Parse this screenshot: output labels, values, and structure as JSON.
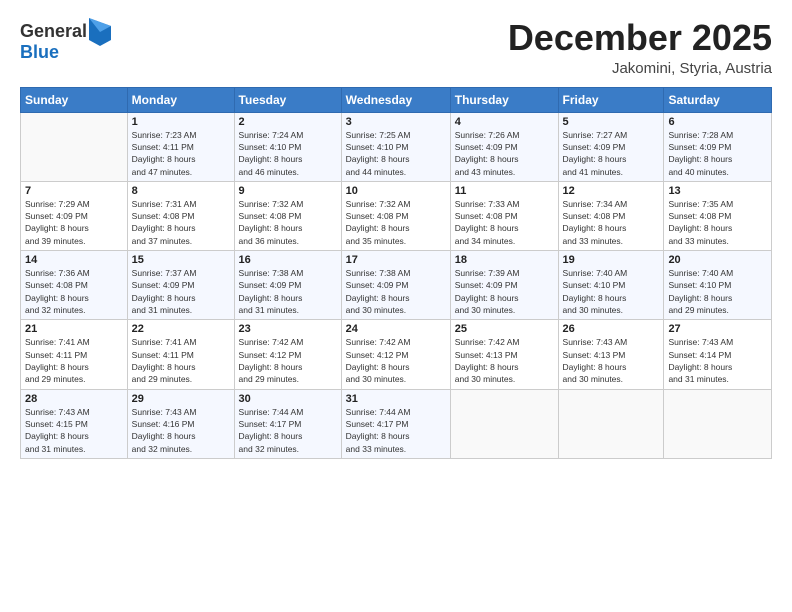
{
  "logo": {
    "general": "General",
    "blue": "Blue"
  },
  "header": {
    "month": "December 2025",
    "location": "Jakomini, Styria, Austria"
  },
  "days_of_week": [
    "Sunday",
    "Monday",
    "Tuesday",
    "Wednesday",
    "Thursday",
    "Friday",
    "Saturday"
  ],
  "weeks": [
    [
      {
        "day": "",
        "info": ""
      },
      {
        "day": "1",
        "info": "Sunrise: 7:23 AM\nSunset: 4:11 PM\nDaylight: 8 hours\nand 47 minutes."
      },
      {
        "day": "2",
        "info": "Sunrise: 7:24 AM\nSunset: 4:10 PM\nDaylight: 8 hours\nand 46 minutes."
      },
      {
        "day": "3",
        "info": "Sunrise: 7:25 AM\nSunset: 4:10 PM\nDaylight: 8 hours\nand 44 minutes."
      },
      {
        "day": "4",
        "info": "Sunrise: 7:26 AM\nSunset: 4:09 PM\nDaylight: 8 hours\nand 43 minutes."
      },
      {
        "day": "5",
        "info": "Sunrise: 7:27 AM\nSunset: 4:09 PM\nDaylight: 8 hours\nand 41 minutes."
      },
      {
        "day": "6",
        "info": "Sunrise: 7:28 AM\nSunset: 4:09 PM\nDaylight: 8 hours\nand 40 minutes."
      }
    ],
    [
      {
        "day": "7",
        "info": "Sunrise: 7:29 AM\nSunset: 4:09 PM\nDaylight: 8 hours\nand 39 minutes."
      },
      {
        "day": "8",
        "info": "Sunrise: 7:31 AM\nSunset: 4:08 PM\nDaylight: 8 hours\nand 37 minutes."
      },
      {
        "day": "9",
        "info": "Sunrise: 7:32 AM\nSunset: 4:08 PM\nDaylight: 8 hours\nand 36 minutes."
      },
      {
        "day": "10",
        "info": "Sunrise: 7:32 AM\nSunset: 4:08 PM\nDaylight: 8 hours\nand 35 minutes."
      },
      {
        "day": "11",
        "info": "Sunrise: 7:33 AM\nSunset: 4:08 PM\nDaylight: 8 hours\nand 34 minutes."
      },
      {
        "day": "12",
        "info": "Sunrise: 7:34 AM\nSunset: 4:08 PM\nDaylight: 8 hours\nand 33 minutes."
      },
      {
        "day": "13",
        "info": "Sunrise: 7:35 AM\nSunset: 4:08 PM\nDaylight: 8 hours\nand 33 minutes."
      }
    ],
    [
      {
        "day": "14",
        "info": "Sunrise: 7:36 AM\nSunset: 4:08 PM\nDaylight: 8 hours\nand 32 minutes."
      },
      {
        "day": "15",
        "info": "Sunrise: 7:37 AM\nSunset: 4:09 PM\nDaylight: 8 hours\nand 31 minutes."
      },
      {
        "day": "16",
        "info": "Sunrise: 7:38 AM\nSunset: 4:09 PM\nDaylight: 8 hours\nand 31 minutes."
      },
      {
        "day": "17",
        "info": "Sunrise: 7:38 AM\nSunset: 4:09 PM\nDaylight: 8 hours\nand 30 minutes."
      },
      {
        "day": "18",
        "info": "Sunrise: 7:39 AM\nSunset: 4:09 PM\nDaylight: 8 hours\nand 30 minutes."
      },
      {
        "day": "19",
        "info": "Sunrise: 7:40 AM\nSunset: 4:10 PM\nDaylight: 8 hours\nand 30 minutes."
      },
      {
        "day": "20",
        "info": "Sunrise: 7:40 AM\nSunset: 4:10 PM\nDaylight: 8 hours\nand 29 minutes."
      }
    ],
    [
      {
        "day": "21",
        "info": "Sunrise: 7:41 AM\nSunset: 4:11 PM\nDaylight: 8 hours\nand 29 minutes."
      },
      {
        "day": "22",
        "info": "Sunrise: 7:41 AM\nSunset: 4:11 PM\nDaylight: 8 hours\nand 29 minutes."
      },
      {
        "day": "23",
        "info": "Sunrise: 7:42 AM\nSunset: 4:12 PM\nDaylight: 8 hours\nand 29 minutes."
      },
      {
        "day": "24",
        "info": "Sunrise: 7:42 AM\nSunset: 4:12 PM\nDaylight: 8 hours\nand 30 minutes."
      },
      {
        "day": "25",
        "info": "Sunrise: 7:42 AM\nSunset: 4:13 PM\nDaylight: 8 hours\nand 30 minutes."
      },
      {
        "day": "26",
        "info": "Sunrise: 7:43 AM\nSunset: 4:13 PM\nDaylight: 8 hours\nand 30 minutes."
      },
      {
        "day": "27",
        "info": "Sunrise: 7:43 AM\nSunset: 4:14 PM\nDaylight: 8 hours\nand 31 minutes."
      }
    ],
    [
      {
        "day": "28",
        "info": "Sunrise: 7:43 AM\nSunset: 4:15 PM\nDaylight: 8 hours\nand 31 minutes."
      },
      {
        "day": "29",
        "info": "Sunrise: 7:43 AM\nSunset: 4:16 PM\nDaylight: 8 hours\nand 32 minutes."
      },
      {
        "day": "30",
        "info": "Sunrise: 7:44 AM\nSunset: 4:17 PM\nDaylight: 8 hours\nand 32 minutes."
      },
      {
        "day": "31",
        "info": "Sunrise: 7:44 AM\nSunset: 4:17 PM\nDaylight: 8 hours\nand 33 minutes."
      },
      {
        "day": "",
        "info": ""
      },
      {
        "day": "",
        "info": ""
      },
      {
        "day": "",
        "info": ""
      }
    ]
  ]
}
